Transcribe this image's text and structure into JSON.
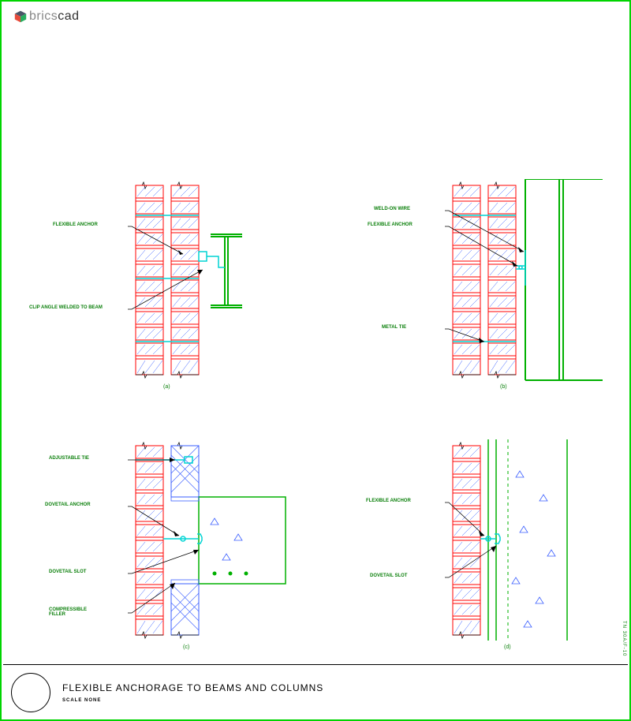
{
  "logo": {
    "text_prefix": "brics",
    "text_suffix": "cad"
  },
  "title": {
    "main": "FLEXIBLE ANCHORAGE TO BEAMS AND COLUMNS",
    "scale": "SCALE NONE"
  },
  "side_ref": "TN 30A/F-10",
  "details": {
    "a": {
      "sub": "(a)",
      "labels": {
        "flexible_anchor": "FLEXIBLE ANCHOR",
        "clip_angle": "CLIP ANGLE WELDED TO BEAM"
      }
    },
    "b": {
      "sub": "(b)",
      "labels": {
        "weld_on_wire": "WELD-ON WIRE",
        "flexible_anchor": "FLEXIBLE ANCHOR",
        "metal_tie": "METAL TIE"
      }
    },
    "c": {
      "sub": "(c)",
      "labels": {
        "adjustable_tie": "ADJUSTABLE TIE",
        "dovetail_anchor": "DOVETAIL ANCHOR",
        "dovetail_slot": "DOVETAIL SLOT",
        "compressible_filler": "COMPRESSIBLE FILLER"
      }
    },
    "d": {
      "sub": "(d)",
      "labels": {
        "flexible_anchor": "FLEXIBLE ANCHOR",
        "dovetail_slot": "DOVETAIL SLOT"
      }
    }
  }
}
